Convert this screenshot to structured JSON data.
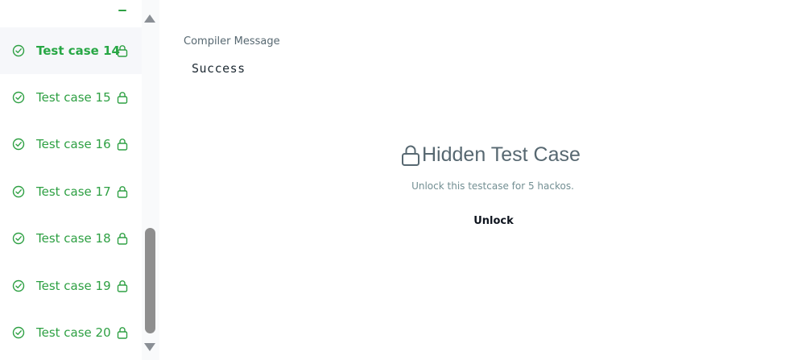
{
  "sidebar": {
    "items": [
      {
        "label": "Test case 14",
        "active": true
      },
      {
        "label": "Test case 15",
        "active": false
      },
      {
        "label": "Test case 16",
        "active": false
      },
      {
        "label": "Test case 17",
        "active": false
      },
      {
        "label": "Test case 18",
        "active": false
      },
      {
        "label": "Test case 19",
        "active": false
      },
      {
        "label": "Test case 20",
        "active": false
      }
    ],
    "status_icon": "check-circle-icon",
    "lock_icon": "lock-icon",
    "accent_color": "#2ea043"
  },
  "main": {
    "compiler_label": "Compiler Message",
    "compiler_output": "Success",
    "hidden_title": "Hidden Test Case",
    "hidden_subtitle": "Unlock this testcase for 5 hackos.",
    "unlock_label": "Unlock"
  }
}
